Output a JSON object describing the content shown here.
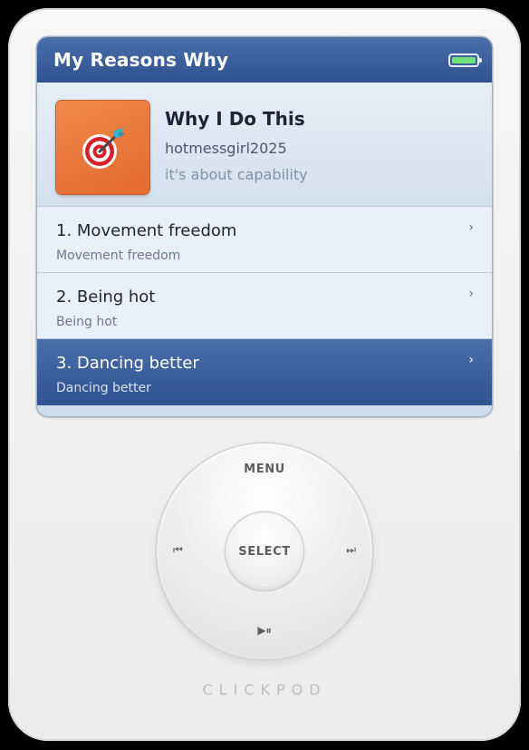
{
  "header": {
    "title": "My Reasons Why",
    "battery_icon": "battery-full-icon",
    "battery_color": "#6fe37a"
  },
  "now_playing": {
    "art_icon": "target-dart-icon",
    "title": "Why I Do This",
    "artist": "hotmessgirl2025",
    "subtitle": "it's about capability"
  },
  "list": {
    "items": [
      {
        "title": "1. Movement freedom",
        "subtitle": "Movement freedom",
        "selected": false
      },
      {
        "title": "2. Being hot",
        "subtitle": "Being hot",
        "selected": false
      },
      {
        "title": "3. Dancing better",
        "subtitle": "Dancing better",
        "selected": true
      }
    ],
    "chevron": "›"
  },
  "wheel": {
    "menu_label": "MENU",
    "select_label": "SELECT",
    "prev_glyph": "⏮",
    "next_glyph": "⏭",
    "play_glyph": "▶︎⏸"
  },
  "brand": "CLICKPOD",
  "colors": {
    "accent": "#2f5290",
    "screen_bg": "#dbe6f3",
    "art_bg": "#e4692d"
  }
}
